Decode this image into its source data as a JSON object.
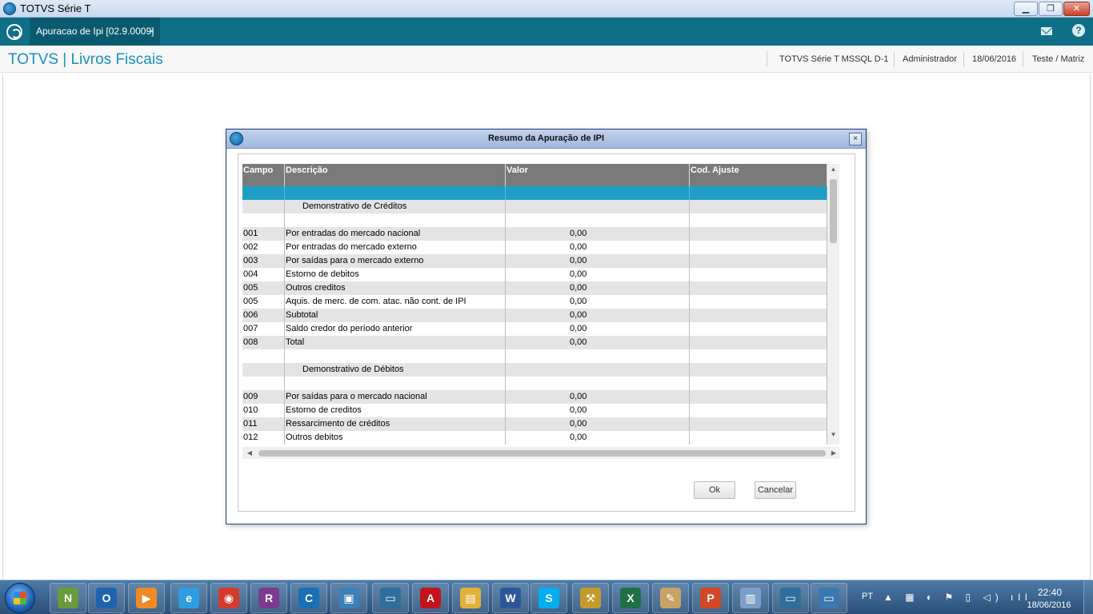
{
  "window": {
    "title": "TOTVS Série T",
    "minimize": "▁",
    "maximize": "❐",
    "close": "✕"
  },
  "tabbar": {
    "tab_label": "Apuracao de Ipi [02.9.0009]",
    "tab_close": "×",
    "help": "?"
  },
  "header": {
    "app_title": "TOTVS | Livros Fiscais",
    "environment": "TOTVS Série T  MSSQL D-1",
    "user": "Administrador",
    "date": "18/06/2016",
    "branch": "Teste / Matriz"
  },
  "dialog": {
    "title": "Resumo da Apuração de IPI",
    "close": "×",
    "columns": [
      "Campo",
      "Descrição",
      "Valor",
      "Cod. Ajuste"
    ],
    "rows": [
      {
        "campo": "",
        "descricao": "",
        "valor": "",
        "cod": "",
        "style": "sel"
      },
      {
        "campo": "",
        "descricao": "Demonstrativo de Créditos",
        "valor": "",
        "cod": "",
        "style": "section"
      },
      {
        "campo": "",
        "descricao": "",
        "valor": "",
        "cod": ""
      },
      {
        "campo": "001",
        "descricao": "Por entradas do mercado nacional",
        "valor": "0,00",
        "cod": ""
      },
      {
        "campo": "002",
        "descricao": "Por entradas do mercado externo",
        "valor": "0,00",
        "cod": ""
      },
      {
        "campo": "003",
        "descricao": "Por saídas para o mercado externo",
        "valor": "0,00",
        "cod": ""
      },
      {
        "campo": "004",
        "descricao": "Estorno de debitos",
        "valor": "0,00",
        "cod": ""
      },
      {
        "campo": "005",
        "descricao": "Outros creditos",
        "valor": "0,00",
        "cod": ""
      },
      {
        "campo": "005",
        "descricao": "Aquis. de merc. de com. atac. não cont. de IPI",
        "valor": "0,00",
        "cod": ""
      },
      {
        "campo": "006",
        "descricao": "Subtotal",
        "valor": "0,00",
        "cod": ""
      },
      {
        "campo": "007",
        "descricao": "Saldo credor do período anterior",
        "valor": "0,00",
        "cod": ""
      },
      {
        "campo": "008",
        "descricao": "Total",
        "valor": "0,00",
        "cod": ""
      },
      {
        "campo": "",
        "descricao": "",
        "valor": "",
        "cod": ""
      },
      {
        "campo": "",
        "descricao": "Demonstrativo de Débitos",
        "valor": "",
        "cod": "",
        "style": "section"
      },
      {
        "campo": "",
        "descricao": "",
        "valor": "",
        "cod": ""
      },
      {
        "campo": "009",
        "descricao": "Por saídas para o mercado nacional",
        "valor": "0,00",
        "cod": ""
      },
      {
        "campo": "010",
        "descricao": "Estorno de creditos",
        "valor": "0,00",
        "cod": ""
      },
      {
        "campo": "011",
        "descricao": "Ressarcimento de créditos",
        "valor": "0,00",
        "cod": ""
      },
      {
        "campo": "012",
        "descricao": "Outros debitos",
        "valor": "0,00",
        "cod": ""
      }
    ],
    "ok_label": "Ok",
    "cancel_label": "Cancelar"
  },
  "scroll": {
    "up": "▲",
    "down": "▼",
    "left": "◀",
    "right": "▶"
  },
  "taskbar": {
    "apps": [
      {
        "name": "notepad-plus-plus-icon",
        "glyph": "N",
        "color": "#6a9a3a"
      },
      {
        "name": "outlook-icon",
        "glyph": "O",
        "color": "#1f63b0"
      },
      {
        "name": "media-player-icon",
        "glyph": "▶",
        "color": "#f08a24"
      },
      {
        "name": "internet-explorer-icon",
        "glyph": "e",
        "color": "#2d9ee0"
      },
      {
        "name": "chrome-icon",
        "glyph": "◉",
        "color": "#d33b2c"
      },
      {
        "name": "winrar-icon",
        "glyph": "R",
        "color": "#7b3b8f"
      },
      {
        "name": "ccleaner-icon",
        "glyph": "C",
        "color": "#1a6fb5"
      },
      {
        "name": "photo-viewer-icon",
        "glyph": "▣",
        "color": "#3d7fb8"
      },
      {
        "name": "remote-desktop-icon",
        "glyph": "▭",
        "color": "#2f6f9e"
      },
      {
        "name": "adobe-reader-icon",
        "glyph": "A",
        "color": "#c4141b"
      },
      {
        "name": "file-explorer-icon",
        "glyph": "▤",
        "color": "#e0b23a"
      },
      {
        "name": "word-icon",
        "glyph": "W",
        "color": "#2b579a"
      },
      {
        "name": "skype-icon",
        "glyph": "S",
        "color": "#00aff0"
      },
      {
        "name": "database-tools-icon",
        "glyph": "⚒",
        "color": "#c49a2a"
      },
      {
        "name": "excel-icon",
        "glyph": "X",
        "color": "#1e7145"
      },
      {
        "name": "paint-icon",
        "glyph": "✎",
        "color": "#c8a266"
      },
      {
        "name": "powerpoint-icon",
        "glyph": "P",
        "color": "#d24726"
      },
      {
        "name": "notes-icon",
        "glyph": "▥",
        "color": "#7aa0c8"
      },
      {
        "name": "totvs-smartclient-icon",
        "glyph": "▭",
        "color": "#2f6f9e"
      },
      {
        "name": "monitor-icon",
        "glyph": "▭",
        "color": "#3b78b0"
      }
    ],
    "language": "PT",
    "tray_icons": "▲ ▦ ◐ ⚑ ▯ ◁) ıll",
    "time": "22:40",
    "date": "18/06/2016"
  }
}
